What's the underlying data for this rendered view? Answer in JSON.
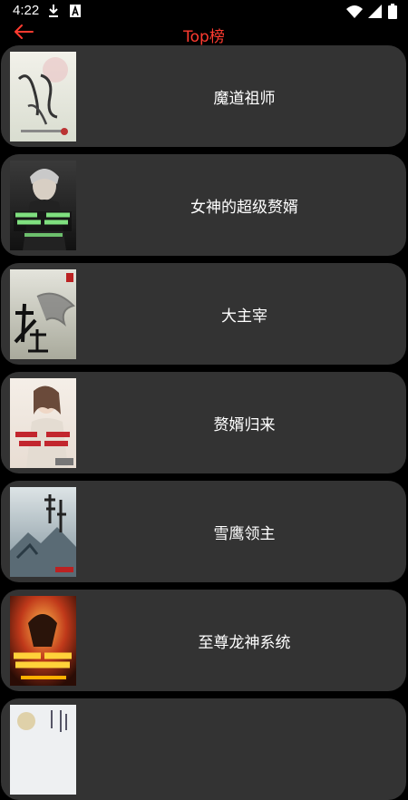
{
  "status_bar": {
    "time": "4:22",
    "left_icons": [
      "download-icon",
      "notification-a-icon"
    ],
    "right_icons": [
      "wifi-icon",
      "signal-icon",
      "battery-icon"
    ]
  },
  "app_bar": {
    "back_icon": "arrow-left-icon",
    "title": "Top榜",
    "accent_color": "#ff3b30"
  },
  "books": [
    {
      "title": "魔道祖师",
      "cover_text": "魔道祖师"
    },
    {
      "title": "女神的超级赘婿",
      "cover_text": "女神的超级赘婿"
    },
    {
      "title": "大主宰",
      "cover_text": "大主宰"
    },
    {
      "title": "赘婿归来",
      "cover_text": "赘婿归来"
    },
    {
      "title": "雪鹰领主",
      "cover_text": "雪鹰领主"
    },
    {
      "title": "至尊龙神系统",
      "cover_text": "至尊龙神系统"
    },
    {
      "title": "",
      "cover_text": ""
    }
  ],
  "colors": {
    "background": "#000000",
    "card": "#333333",
    "text": "#ffffff"
  }
}
